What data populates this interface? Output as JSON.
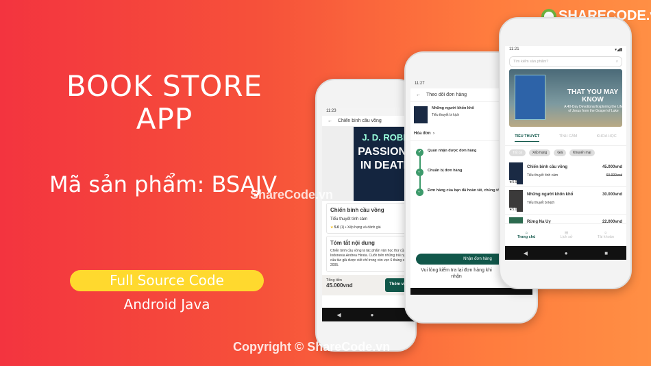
{
  "promo": {
    "title_line1": "BOOK STORE",
    "title_line2": "APP",
    "product_code": "Mã sản phẩm: BSAJV",
    "badge": "Full Source Code",
    "platform": "Android Java",
    "watermark": "ShareCode.vn",
    "copyright": "Copyright © ShareCode.vn",
    "logo_text": "SHARECODE.vn"
  },
  "detail": {
    "time": "11:23",
    "title": "Chiến binh cầu vồng",
    "cover_author": "J. D. ROBB",
    "cover_title": "PASSIONS IN DEATH",
    "name": "Chiến binh cầu vồng",
    "genre": "Tiểu thuyết tình cảm",
    "rating": "5.0",
    "rating_count": "(1)",
    "rating_link": "Xếp hạng và đánh giá",
    "summary_title": "Tóm tắt nội dung",
    "summary": "Chiến binh cầu vồng là tác phẩm văn học thứ của nhà văn Indonesia Andrea Hirata. Cuốn trên những trải nghiệm thời thơ ấu của tác giả được viết chỉ trong vòn vẹn 6 tháng sau đó vào năm 2005.",
    "total_label": "Tổng tiền",
    "total": "45.000vnd",
    "add_button": "Thêm vào"
  },
  "tracking": {
    "time": "11:27",
    "title": "Theo dõi đơn hàng",
    "book": "Những người khốn khổ",
    "genre": "Tiểu thuyết bi kịch",
    "invoice": "Hóa đơn",
    "steps": [
      "Quán nhận được đơn hàng",
      "Chuẩn bị đơn hàng",
      "Đơn hàng của bạn đã hoàn tất, chúng tôi ngay cho bạn"
    ],
    "receive_button": "Nhận đơn hàng",
    "note": "Vui lòng kiểm tra lại đơn hàng khi nhận"
  },
  "home": {
    "time": "11:21",
    "search_placeholder": "Tìm kiếm sản phẩm?",
    "banner_title": "THAT YOU MAY KNOW",
    "banner_sub": "A 40-Day Devotional Exploring the Life of Jesus from the Gospel of Luke",
    "tabs": [
      "TIỂU THUYẾT",
      "TÌNH CẢM",
      "KHOA HỌC"
    ],
    "filters": [
      "Tất cả",
      "Xếp hạng",
      "Giá",
      "Khuyến mại"
    ],
    "books": [
      {
        "name": "Chiến binh cầu vồng",
        "genre": "Tiểu thuyết tình cảm",
        "price": "45.000vnd",
        "old_price": "60.000vnd",
        "rating": "5.0"
      },
      {
        "name": "Những người khốn khổ",
        "genre": "Tiểu thuyết bi kịch",
        "price": "30.000vnd",
        "rating": "5.0"
      },
      {
        "name": "Rừng Na Uy",
        "price": "22.000vnd"
      }
    ],
    "bottom_nav": [
      "Trang chủ",
      "Lịch sử",
      "Tài khoản"
    ]
  },
  "colors": {
    "primary": "#11574a",
    "badge": "#ffd92e"
  }
}
